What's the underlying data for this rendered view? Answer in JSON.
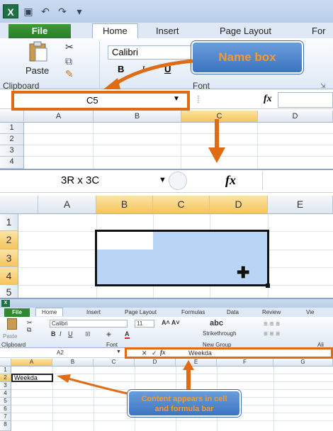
{
  "panel1": {
    "tabs": [
      "File",
      "Home",
      "Insert",
      "Page Layout",
      "For"
    ],
    "clipboard": {
      "paste_label": "Paste",
      "group_label": "Clipboard"
    },
    "font": {
      "name": "Calibri",
      "group_label": "Font"
    },
    "callout": "Name box",
    "name_box": "C5",
    "fx": "fx",
    "columns": [
      "A",
      "B",
      "C",
      "D"
    ],
    "rows": [
      "1",
      "2",
      "3",
      "4"
    ],
    "selected_column": "C"
  },
  "panel2": {
    "name_box": "3R x 3C",
    "fx": "fx",
    "columns": [
      "A",
      "B",
      "C",
      "D",
      "E"
    ],
    "rows": [
      "1",
      "2",
      "3",
      "4",
      "5"
    ],
    "selected_columns": [
      "B",
      "C",
      "D"
    ],
    "selected_rows": [
      "2",
      "3",
      "4"
    ],
    "cursor": "cross-cursor-icon"
  },
  "panel3": {
    "tabs": [
      "File",
      "Home",
      "Insert",
      "Page Layout",
      "Formulas",
      "Data",
      "Review",
      "Vie"
    ],
    "clipboard": {
      "paste_label": "Paste",
      "group_label": "Clipboard"
    },
    "font": {
      "name": "Calibri",
      "size": "11",
      "group_label": "Font"
    },
    "styles": {
      "sample": "abc",
      "strikethrough": "Strikethrough",
      "group_label": "New Group"
    },
    "alignment_label": "Ali",
    "name_box": "A2",
    "fx": "fx",
    "formula_content": "Weekda",
    "columns": [
      "A",
      "B",
      "C",
      "D",
      "E",
      "F",
      "G"
    ],
    "rows": [
      "1",
      "2",
      "3",
      "4",
      "5",
      "6",
      "7",
      "8"
    ],
    "cell_content": "Weekda",
    "callout": "Content appears in cell and formula bar"
  },
  "colors": {
    "accent_orange": "#e06b12",
    "callout_blue": "#4a82cf",
    "selection": "#b9d5f5",
    "file_green": "#2f8a2f"
  }
}
